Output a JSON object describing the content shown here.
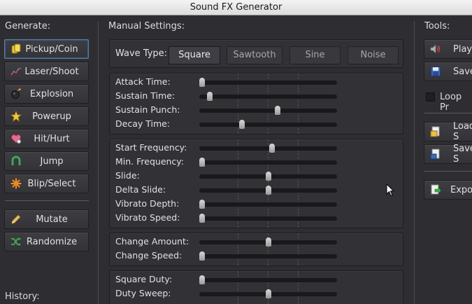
{
  "window": {
    "title": "Sound FX Generator"
  },
  "generate": {
    "heading": "Generate:",
    "buttons": [
      {
        "label": "Pickup/Coin",
        "icon": "coin-icon"
      },
      {
        "label": "Laser/Shoot",
        "icon": "laser-icon"
      },
      {
        "label": "Explosion",
        "icon": "bomb-icon"
      },
      {
        "label": "Powerup",
        "icon": "star-icon"
      },
      {
        "label": "Hit/Hurt",
        "icon": "heart-icon"
      },
      {
        "label": "Jump",
        "icon": "magnet-icon"
      },
      {
        "label": "Blip/Select",
        "icon": "sparkle-icon"
      }
    ],
    "mutate_label": "Mutate",
    "randomize_label": "Randomize",
    "history_heading": "History:"
  },
  "manual": {
    "heading": "Manual Settings:",
    "wave_type_label": "Wave Type:",
    "wave_types": [
      "Square",
      "Sawtooth",
      "Sine",
      "Noise"
    ],
    "selected_wave": "Square",
    "envelope": [
      {
        "label": "Attack Time:",
        "value": 0.0
      },
      {
        "label": "Sustain Time:",
        "value": 0.06
      },
      {
        "label": "Sustain Punch:",
        "value": 0.57
      },
      {
        "label": "Decay Time:",
        "value": 0.3
      }
    ],
    "frequency": [
      {
        "label": "Start Frequency:",
        "value": 0.53
      },
      {
        "label": "Min. Frequency:",
        "value": 0.0
      },
      {
        "label": "Slide:",
        "value": 0.5
      },
      {
        "label": "Delta Slide:",
        "value": 0.5
      },
      {
        "label": "Vibrato Depth:",
        "value": 0.0
      },
      {
        "label": "Vibrato Speed:",
        "value": 0.0
      }
    ],
    "change": [
      {
        "label": "Change Amount:",
        "value": 0.5
      },
      {
        "label": "Change Speed:",
        "value": 0.0
      }
    ],
    "duty": [
      {
        "label": "Square Duty:",
        "value": 0.0
      },
      {
        "label": "Duty Sweep:",
        "value": 0.5
      }
    ]
  },
  "tools": {
    "heading": "Tools:",
    "play_label": "Play",
    "save_label": "Save",
    "loop_label": "Loop Pr",
    "load_sound_label": "Load S",
    "save_sound_label": "Save S",
    "export_label": "Export"
  },
  "colors": {
    "background": "#2e2e32",
    "panel": "#313136",
    "active_border": "#5a7da6"
  }
}
